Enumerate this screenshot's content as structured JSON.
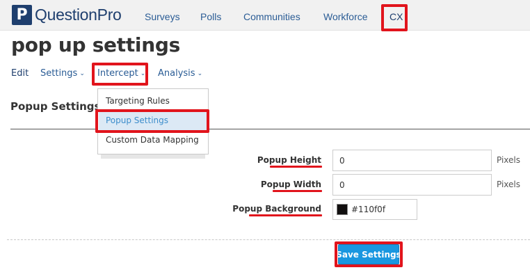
{
  "brand": {
    "mark": "P",
    "name": "QuestionPro"
  },
  "top_nav": {
    "surveys": "Surveys",
    "polls": "Polls",
    "communities": "Communities",
    "workforce": "Workforce",
    "cx": "CX"
  },
  "page": {
    "title": "pop up settings"
  },
  "sub_nav": {
    "edit": "Edit",
    "settings": "Settings",
    "intercept": "Intercept",
    "analysis": "Analysis",
    "chevron": "⌄"
  },
  "dropdown": {
    "items": [
      "Targeting Rules",
      "Popup Settings",
      "Custom Data Mapping"
    ],
    "active": "Popup Settings"
  },
  "section": {
    "title": "Popup Settings"
  },
  "form": {
    "height": {
      "label": "Popup Height",
      "value": "0",
      "unit": "Pixels"
    },
    "width": {
      "label": "Popup Width",
      "value": "0",
      "unit": "Pixels"
    },
    "background": {
      "label": "Popup Background",
      "value": "#110f0f",
      "swatch_color": "#110f0f"
    }
  },
  "actions": {
    "save": "Save Settings"
  },
  "colors": {
    "brand": "#1f3f6e",
    "link": "#2a5c95",
    "highlight": "#e1141c",
    "button": "#1a97e0"
  }
}
